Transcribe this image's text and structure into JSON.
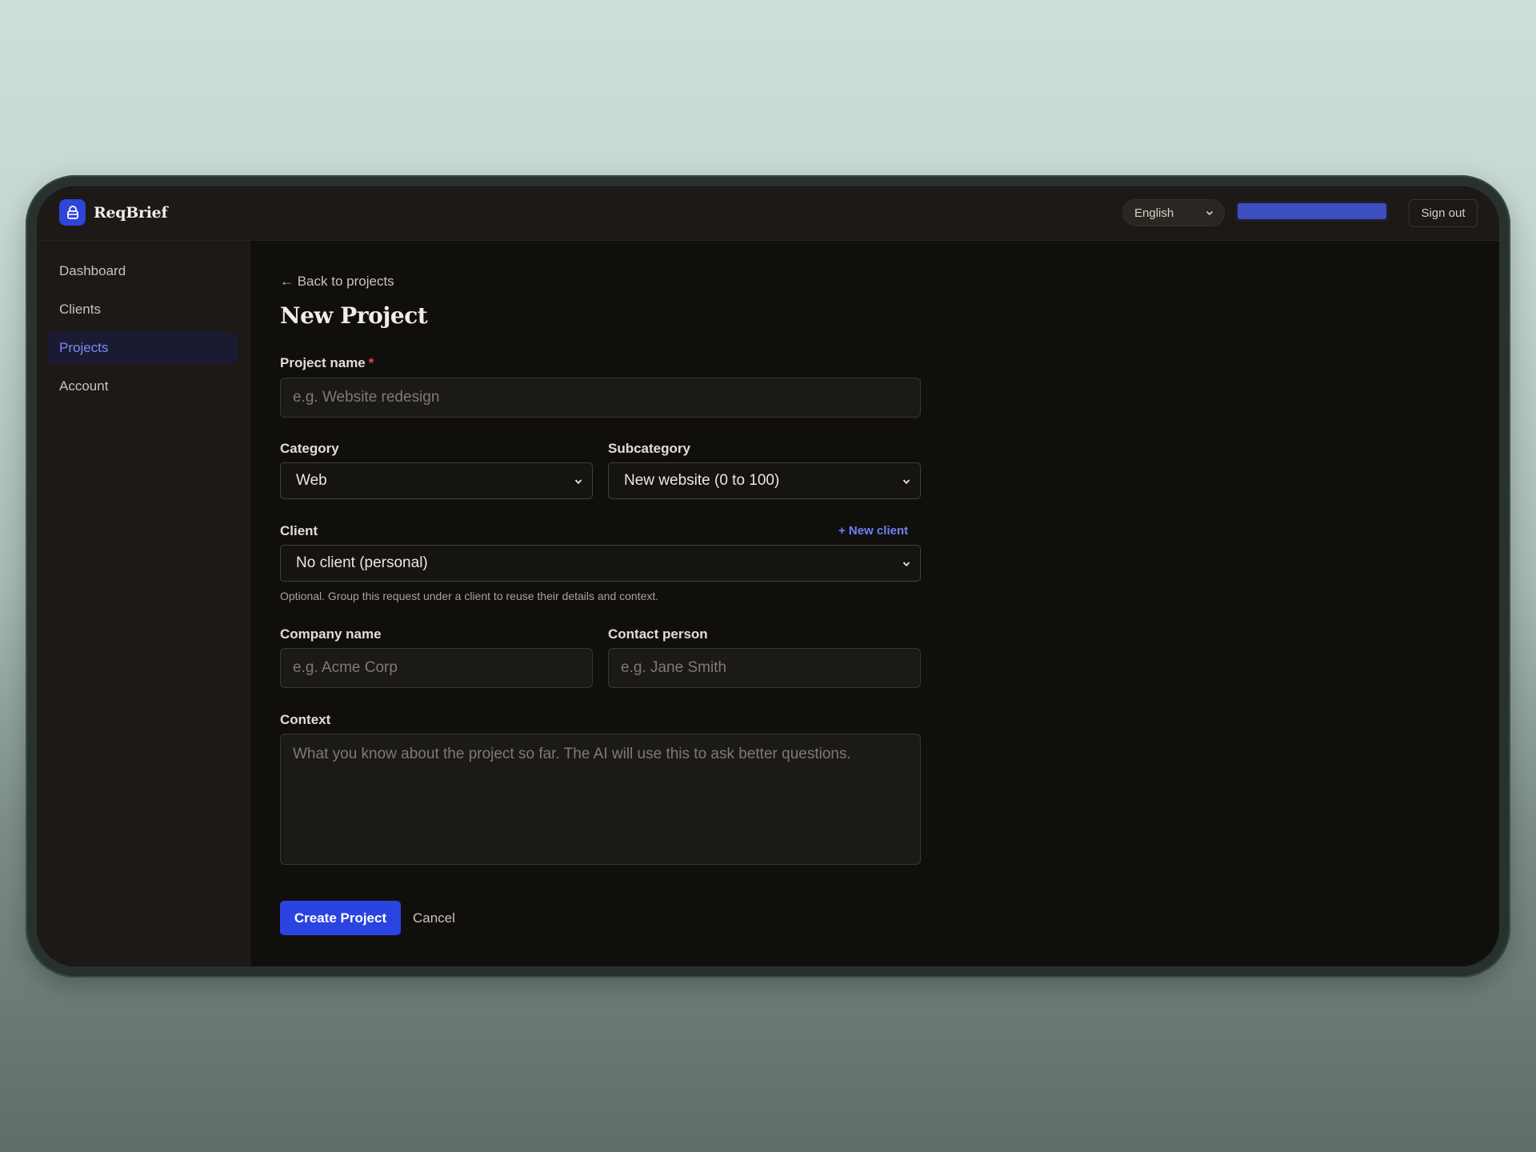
{
  "app": {
    "name": "ReqBrief"
  },
  "header": {
    "language_selected": "English",
    "signout_label": "Sign out"
  },
  "sidebar": {
    "items": [
      {
        "label": "Dashboard",
        "active": false
      },
      {
        "label": "Clients",
        "active": false
      },
      {
        "label": "Projects",
        "active": true
      },
      {
        "label": "Account",
        "active": false
      }
    ]
  },
  "page": {
    "back_link": "← Back to projects",
    "title": "New Project"
  },
  "form": {
    "project_name": {
      "label": "Project name",
      "required_mark": "*",
      "placeholder": "e.g. Website redesign"
    },
    "category": {
      "label": "Category",
      "value": "Web"
    },
    "subcategory": {
      "label": "Subcategory",
      "value": "New website (0 to 100)"
    },
    "client": {
      "label": "Client",
      "value": "No client (personal)",
      "new_client_label": "+ New client",
      "hint": "Optional. Group this request under a client to reuse their details and context."
    },
    "company_name": {
      "label": "Company name",
      "placeholder": "e.g. Acme Corp"
    },
    "contact_person": {
      "label": "Contact person",
      "placeholder": "e.g. Jane Smith"
    },
    "context": {
      "label": "Context",
      "placeholder": "What you know about the project so far. The AI will use this to ask better questions."
    },
    "submit_label": "Create Project",
    "cancel_label": "Cancel"
  },
  "colors": {
    "accent": "#2b43e0",
    "active_nav_text": "#7d8bf5",
    "required": "#e5484d"
  }
}
